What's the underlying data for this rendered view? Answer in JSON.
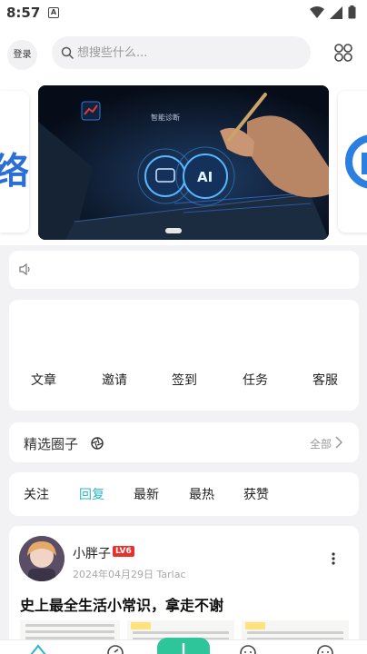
{
  "status_bar": {
    "time": "8:57",
    "notification_badge": "A"
  },
  "header": {
    "login_label": "登录",
    "search_placeholder": "想搜些什么..."
  },
  "banner": {
    "brand_text": "智能诊断",
    "ai_badge": "AI",
    "left_card_text": "络"
  },
  "quick_menu": {
    "items": [
      {
        "label": "文章"
      },
      {
        "label": "邀请"
      },
      {
        "label": "签到"
      },
      {
        "label": "任务"
      },
      {
        "label": "客服"
      }
    ]
  },
  "circles": {
    "title": "精选圈子",
    "all_label": "全部"
  },
  "tabs": {
    "items": [
      {
        "label": "关注"
      },
      {
        "label": "回复"
      },
      {
        "label": "最新"
      },
      {
        "label": "最热"
      },
      {
        "label": "获赞"
      }
    ],
    "active_index": 1
  },
  "post": {
    "username": "小胖子",
    "level": "LV6",
    "date_location": "2024年04月29日 Tarlac",
    "title": "史上最全生活小常识，拿走不谢"
  },
  "colors": {
    "accent": "#2bb6c9",
    "publish": "#2ec59a",
    "level_badge": "#e8312f"
  }
}
